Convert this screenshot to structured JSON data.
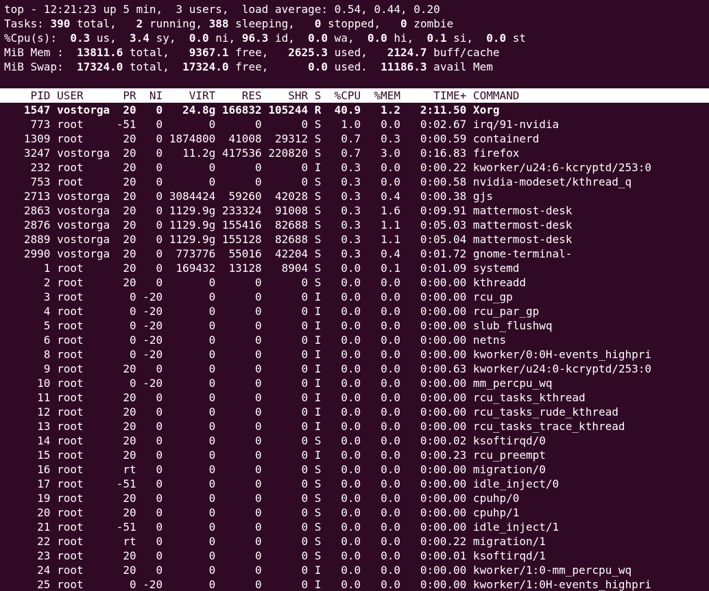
{
  "summary": {
    "top_line": "top - 12:21:23 up 5 min,  3 users,  load average: 0.54, 0.44, 0.20",
    "tasks": {
      "label": "Tasks: ",
      "total": "390",
      "total_lbl": " total,   ",
      "running": "2",
      "running_lbl": " running, ",
      "sleeping": "388",
      "sleeping_lbl": " sleeping,   ",
      "stopped": "0",
      "stopped_lbl": " stopped,   ",
      "zombie": "0",
      "zombie_lbl": " zombie"
    },
    "cpu": {
      "label": "%Cpu(s):  ",
      "us": "0.3",
      "us_lbl": " us,  ",
      "sy": "3.4",
      "sy_lbl": " sy,  ",
      "ni": "0.0",
      "ni_lbl": " ni, ",
      "id": "96.3",
      "id_lbl": " id,  ",
      "wa": "0.0",
      "wa_lbl": " wa,  ",
      "hi": "0.0",
      "hi_lbl": " hi,  ",
      "si": "0.1",
      "si_lbl": " si,  ",
      "st": "0.0",
      "st_lbl": " st"
    },
    "mem": {
      "label": "MiB Mem :  ",
      "total": "13811.6",
      "total_lbl": " total,   ",
      "free": "9367.1",
      "free_lbl": " free,   ",
      "used": "2625.3",
      "used_lbl": " used,   ",
      "cache": "2124.7",
      "cache_lbl": " buff/cache"
    },
    "swap": {
      "label": "MiB Swap:  ",
      "total": "17324.0",
      "total_lbl": " total,  ",
      "free": "17324.0",
      "free_lbl": " free,      ",
      "used": "0.0",
      "used_lbl": " used.  ",
      "avail": "11186.3",
      "avail_lbl": " avail Mem"
    }
  },
  "columns": "    PID USER      PR  NI    VIRT    RES    SHR S  %CPU  %MEM     TIME+ COMMAND",
  "processes": [
    {
      "pid": "1547",
      "user": "vostorga",
      "pr": "20",
      "ni": "0",
      "virt": "24.8g",
      "res": "166832",
      "shr": "105244",
      "s": "R",
      "cpu": "40.9",
      "mem": "1.2",
      "time": "2:11.50",
      "cmd": "Xorg",
      "highlight": true
    },
    {
      "pid": "773",
      "user": "root",
      "pr": "-51",
      "ni": "0",
      "virt": "0",
      "res": "0",
      "shr": "0",
      "s": "S",
      "cpu": "1.0",
      "mem": "0.0",
      "time": "0:02.67",
      "cmd": "irq/91-nvidia"
    },
    {
      "pid": "1309",
      "user": "root",
      "pr": "20",
      "ni": "0",
      "virt": "1874800",
      "res": "41008",
      "shr": "29312",
      "s": "S",
      "cpu": "0.7",
      "mem": "0.3",
      "time": "0:00.59",
      "cmd": "containerd"
    },
    {
      "pid": "3247",
      "user": "vostorga",
      "pr": "20",
      "ni": "0",
      "virt": "11.2g",
      "res": "417536",
      "shr": "220820",
      "s": "S",
      "cpu": "0.7",
      "mem": "3.0",
      "time": "0:16.83",
      "cmd": "firefox"
    },
    {
      "pid": "232",
      "user": "root",
      "pr": "20",
      "ni": "0",
      "virt": "0",
      "res": "0",
      "shr": "0",
      "s": "I",
      "cpu": "0.3",
      "mem": "0.0",
      "time": "0:00.22",
      "cmd": "kworker/u24:6-kcryptd/253:0"
    },
    {
      "pid": "753",
      "user": "root",
      "pr": "20",
      "ni": "0",
      "virt": "0",
      "res": "0",
      "shr": "0",
      "s": "S",
      "cpu": "0.3",
      "mem": "0.0",
      "time": "0:00.58",
      "cmd": "nvidia-modeset/kthread_q"
    },
    {
      "pid": "2713",
      "user": "vostorga",
      "pr": "20",
      "ni": "0",
      "virt": "3084424",
      "res": "59260",
      "shr": "42028",
      "s": "S",
      "cpu": "0.3",
      "mem": "0.4",
      "time": "0:00.38",
      "cmd": "gjs"
    },
    {
      "pid": "2863",
      "user": "vostorga",
      "pr": "20",
      "ni": "0",
      "virt": "1129.9g",
      "res": "233324",
      "shr": "91008",
      "s": "S",
      "cpu": "0.3",
      "mem": "1.6",
      "time": "0:09.91",
      "cmd": "mattermost-desk"
    },
    {
      "pid": "2876",
      "user": "vostorga",
      "pr": "20",
      "ni": "0",
      "virt": "1129.9g",
      "res": "155416",
      "shr": "82688",
      "s": "S",
      "cpu": "0.3",
      "mem": "1.1",
      "time": "0:05.03",
      "cmd": "mattermost-desk"
    },
    {
      "pid": "2889",
      "user": "vostorga",
      "pr": "20",
      "ni": "0",
      "virt": "1129.9g",
      "res": "155128",
      "shr": "82688",
      "s": "S",
      "cpu": "0.3",
      "mem": "1.1",
      "time": "0:05.04",
      "cmd": "mattermost-desk"
    },
    {
      "pid": "2990",
      "user": "vostorga",
      "pr": "20",
      "ni": "0",
      "virt": "773776",
      "res": "55016",
      "shr": "42204",
      "s": "S",
      "cpu": "0.3",
      "mem": "0.4",
      "time": "0:01.72",
      "cmd": "gnome-terminal-"
    },
    {
      "pid": "1",
      "user": "root",
      "pr": "20",
      "ni": "0",
      "virt": "169432",
      "res": "13128",
      "shr": "8904",
      "s": "S",
      "cpu": "0.0",
      "mem": "0.1",
      "time": "0:01.09",
      "cmd": "systemd"
    },
    {
      "pid": "2",
      "user": "root",
      "pr": "20",
      "ni": "0",
      "virt": "0",
      "res": "0",
      "shr": "0",
      "s": "S",
      "cpu": "0.0",
      "mem": "0.0",
      "time": "0:00.00",
      "cmd": "kthreadd"
    },
    {
      "pid": "3",
      "user": "root",
      "pr": "0",
      "ni": "-20",
      "virt": "0",
      "res": "0",
      "shr": "0",
      "s": "I",
      "cpu": "0.0",
      "mem": "0.0",
      "time": "0:00.00",
      "cmd": "rcu_gp"
    },
    {
      "pid": "4",
      "user": "root",
      "pr": "0",
      "ni": "-20",
      "virt": "0",
      "res": "0",
      "shr": "0",
      "s": "I",
      "cpu": "0.0",
      "mem": "0.0",
      "time": "0:00.00",
      "cmd": "rcu_par_gp"
    },
    {
      "pid": "5",
      "user": "root",
      "pr": "0",
      "ni": "-20",
      "virt": "0",
      "res": "0",
      "shr": "0",
      "s": "I",
      "cpu": "0.0",
      "mem": "0.0",
      "time": "0:00.00",
      "cmd": "slub_flushwq"
    },
    {
      "pid": "6",
      "user": "root",
      "pr": "0",
      "ni": "-20",
      "virt": "0",
      "res": "0",
      "shr": "0",
      "s": "I",
      "cpu": "0.0",
      "mem": "0.0",
      "time": "0:00.00",
      "cmd": "netns"
    },
    {
      "pid": "8",
      "user": "root",
      "pr": "0",
      "ni": "-20",
      "virt": "0",
      "res": "0",
      "shr": "0",
      "s": "I",
      "cpu": "0.0",
      "mem": "0.0",
      "time": "0:00.00",
      "cmd": "kworker/0:0H-events_highpri"
    },
    {
      "pid": "9",
      "user": "root",
      "pr": "20",
      "ni": "0",
      "virt": "0",
      "res": "0",
      "shr": "0",
      "s": "I",
      "cpu": "0.0",
      "mem": "0.0",
      "time": "0:00.63",
      "cmd": "kworker/u24:0-kcryptd/253:0"
    },
    {
      "pid": "10",
      "user": "root",
      "pr": "0",
      "ni": "-20",
      "virt": "0",
      "res": "0",
      "shr": "0",
      "s": "I",
      "cpu": "0.0",
      "mem": "0.0",
      "time": "0:00.00",
      "cmd": "mm_percpu_wq"
    },
    {
      "pid": "11",
      "user": "root",
      "pr": "20",
      "ni": "0",
      "virt": "0",
      "res": "0",
      "shr": "0",
      "s": "I",
      "cpu": "0.0",
      "mem": "0.0",
      "time": "0:00.00",
      "cmd": "rcu_tasks_kthread"
    },
    {
      "pid": "12",
      "user": "root",
      "pr": "20",
      "ni": "0",
      "virt": "0",
      "res": "0",
      "shr": "0",
      "s": "I",
      "cpu": "0.0",
      "mem": "0.0",
      "time": "0:00.00",
      "cmd": "rcu_tasks_rude_kthread"
    },
    {
      "pid": "13",
      "user": "root",
      "pr": "20",
      "ni": "0",
      "virt": "0",
      "res": "0",
      "shr": "0",
      "s": "I",
      "cpu": "0.0",
      "mem": "0.0",
      "time": "0:00.00",
      "cmd": "rcu_tasks_trace_kthread"
    },
    {
      "pid": "14",
      "user": "root",
      "pr": "20",
      "ni": "0",
      "virt": "0",
      "res": "0",
      "shr": "0",
      "s": "S",
      "cpu": "0.0",
      "mem": "0.0",
      "time": "0:00.02",
      "cmd": "ksoftirqd/0"
    },
    {
      "pid": "15",
      "user": "root",
      "pr": "20",
      "ni": "0",
      "virt": "0",
      "res": "0",
      "shr": "0",
      "s": "I",
      "cpu": "0.0",
      "mem": "0.0",
      "time": "0:00.23",
      "cmd": "rcu_preempt"
    },
    {
      "pid": "16",
      "user": "root",
      "pr": "rt",
      "ni": "0",
      "virt": "0",
      "res": "0",
      "shr": "0",
      "s": "S",
      "cpu": "0.0",
      "mem": "0.0",
      "time": "0:00.00",
      "cmd": "migration/0"
    },
    {
      "pid": "17",
      "user": "root",
      "pr": "-51",
      "ni": "0",
      "virt": "0",
      "res": "0",
      "shr": "0",
      "s": "S",
      "cpu": "0.0",
      "mem": "0.0",
      "time": "0:00.00",
      "cmd": "idle_inject/0"
    },
    {
      "pid": "19",
      "user": "root",
      "pr": "20",
      "ni": "0",
      "virt": "0",
      "res": "0",
      "shr": "0",
      "s": "S",
      "cpu": "0.0",
      "mem": "0.0",
      "time": "0:00.00",
      "cmd": "cpuhp/0"
    },
    {
      "pid": "20",
      "user": "root",
      "pr": "20",
      "ni": "0",
      "virt": "0",
      "res": "0",
      "shr": "0",
      "s": "S",
      "cpu": "0.0",
      "mem": "0.0",
      "time": "0:00.00",
      "cmd": "cpuhp/1"
    },
    {
      "pid": "21",
      "user": "root",
      "pr": "-51",
      "ni": "0",
      "virt": "0",
      "res": "0",
      "shr": "0",
      "s": "S",
      "cpu": "0.0",
      "mem": "0.0",
      "time": "0:00.00",
      "cmd": "idle_inject/1"
    },
    {
      "pid": "22",
      "user": "root",
      "pr": "rt",
      "ni": "0",
      "virt": "0",
      "res": "0",
      "shr": "0",
      "s": "S",
      "cpu": "0.0",
      "mem": "0.0",
      "time": "0:00.22",
      "cmd": "migration/1"
    },
    {
      "pid": "23",
      "user": "root",
      "pr": "20",
      "ni": "0",
      "virt": "0",
      "res": "0",
      "shr": "0",
      "s": "S",
      "cpu": "0.0",
      "mem": "0.0",
      "time": "0:00.01",
      "cmd": "ksoftirqd/1"
    },
    {
      "pid": "24",
      "user": "root",
      "pr": "20",
      "ni": "0",
      "virt": "0",
      "res": "0",
      "shr": "0",
      "s": "I",
      "cpu": "0.0",
      "mem": "0.0",
      "time": "0:00.00",
      "cmd": "kworker/1:0-mm_percpu_wq"
    },
    {
      "pid": "25",
      "user": "root",
      "pr": "0",
      "ni": "-20",
      "virt": "0",
      "res": "0",
      "shr": "0",
      "s": "I",
      "cpu": "0.0",
      "mem": "0.0",
      "time": "0:00.00",
      "cmd": "kworker/1:0H-events_highpri"
    }
  ]
}
